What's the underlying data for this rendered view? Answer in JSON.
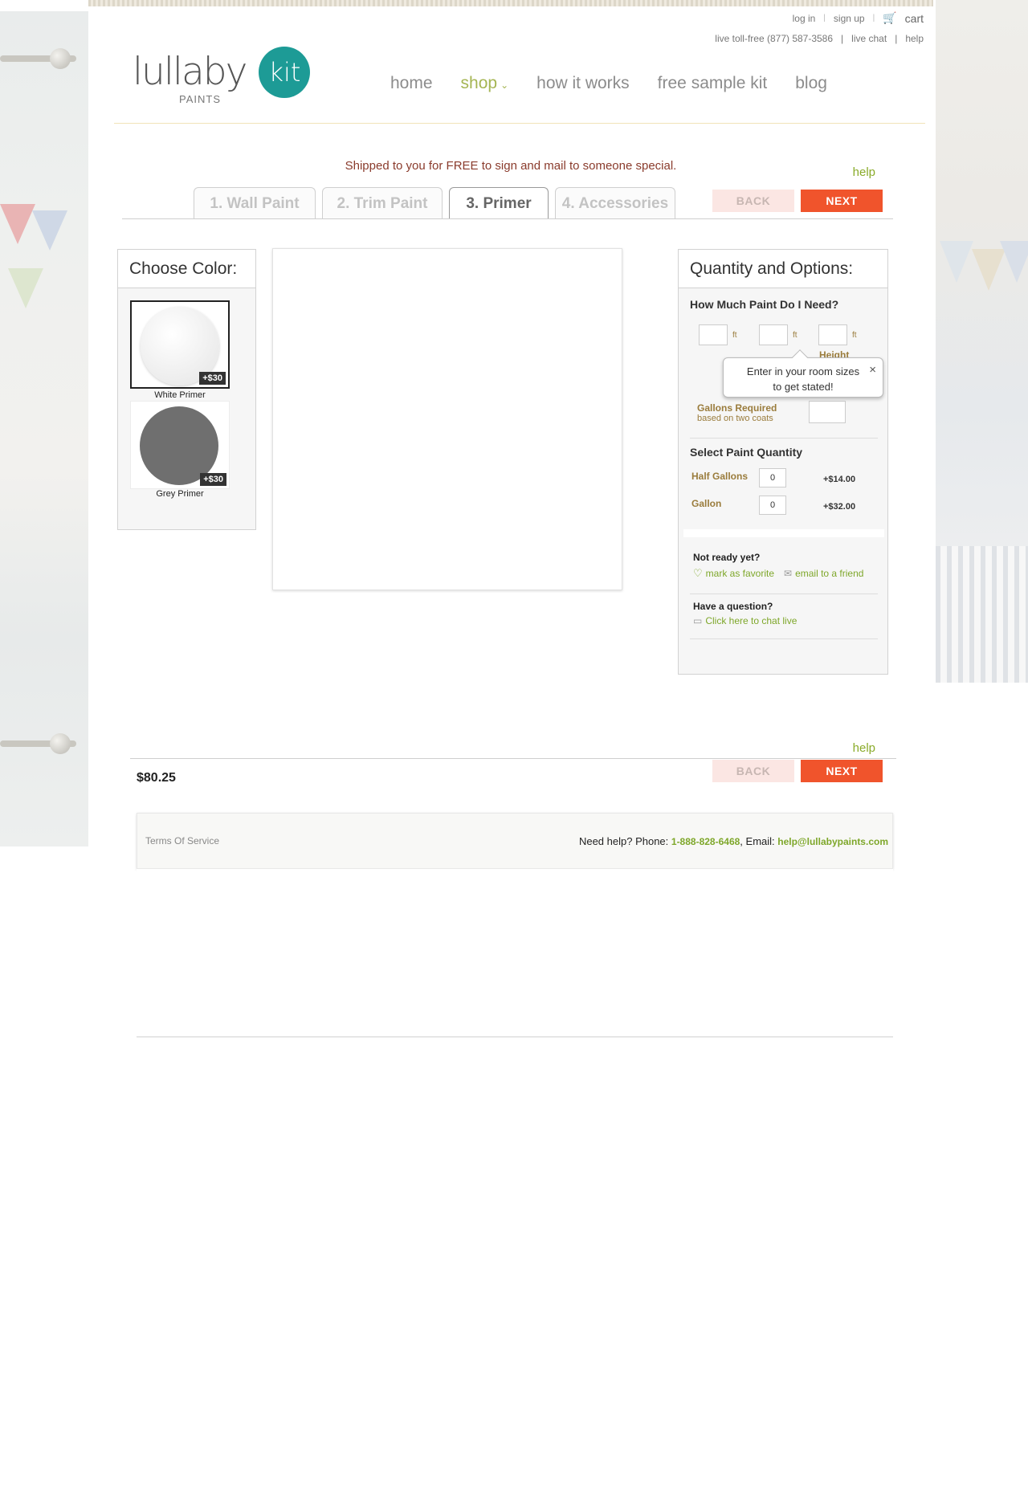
{
  "header": {
    "util_links": [
      "log in",
      "sign up"
    ],
    "cart_label": "cart",
    "contact": {
      "phone": "live toll-free (877) 587-3586",
      "chat": "live chat",
      "help": "help"
    },
    "logo": {
      "word": "lullaby",
      "sub": "PAINTS",
      "badge": "kit"
    },
    "nav": [
      {
        "label": "home"
      },
      {
        "label": "shop"
      },
      {
        "label": "how it works"
      },
      {
        "label": "free sample kit"
      },
      {
        "label": "blog"
      }
    ]
  },
  "wizard": {
    "promo": "Shipped to you for FREE to sign and mail to someone special.",
    "help": "help",
    "tabs": [
      {
        "label": "1. Wall Paint"
      },
      {
        "label": "2. Trim Paint"
      },
      {
        "label": "3. Primer"
      },
      {
        "label": "4. Accessories"
      }
    ],
    "back_label": "BACK",
    "next_label": "NEXT"
  },
  "choose_color": {
    "title": "Choose Color:",
    "swatches": [
      {
        "name": "White Primer",
        "price": "+$30",
        "color": "#f2f2f2"
      },
      {
        "name": "Grey Primer",
        "price": "+$30",
        "color": "#6f6f6f"
      }
    ]
  },
  "options": {
    "title": "Quantity and Options:",
    "how_much": "How Much Paint Do I Need?",
    "unit": "ft",
    "height_label": "Height",
    "tooltip": {
      "line1": "Enter in your room sizes",
      "line2": "to get stated!",
      "close": "×"
    },
    "gallons_required": "Gallons Required",
    "based_on": "based on two coats",
    "select_quantity": "Select Paint Quantity",
    "quantities": [
      {
        "label": "Half Gallons",
        "value": "0",
        "price": "+$14.00"
      },
      {
        "label": "Gallon",
        "value": "0",
        "price": "+$32.00"
      }
    ],
    "not_ready": "Not ready yet?",
    "mark_favorite": "mark as favorite",
    "email_friend": "email to a friend",
    "have_question": "Have a question?",
    "chat_live": "Click here to chat live"
  },
  "bottom": {
    "help": "help",
    "total": "$80.25",
    "back_label": "BACK",
    "next_label": "NEXT"
  },
  "footer": {
    "terms": "Terms Of Service",
    "need_help_prefix": "Need help? Phone: ",
    "phone": "1-888-828-6468",
    "email_prefix": ", Email: ",
    "email": "help@lullabypaints.com"
  },
  "colors": {
    "accent_green": "#8aab2a",
    "next_orange": "#f0542c",
    "brand_teal": "#1d9b96"
  }
}
